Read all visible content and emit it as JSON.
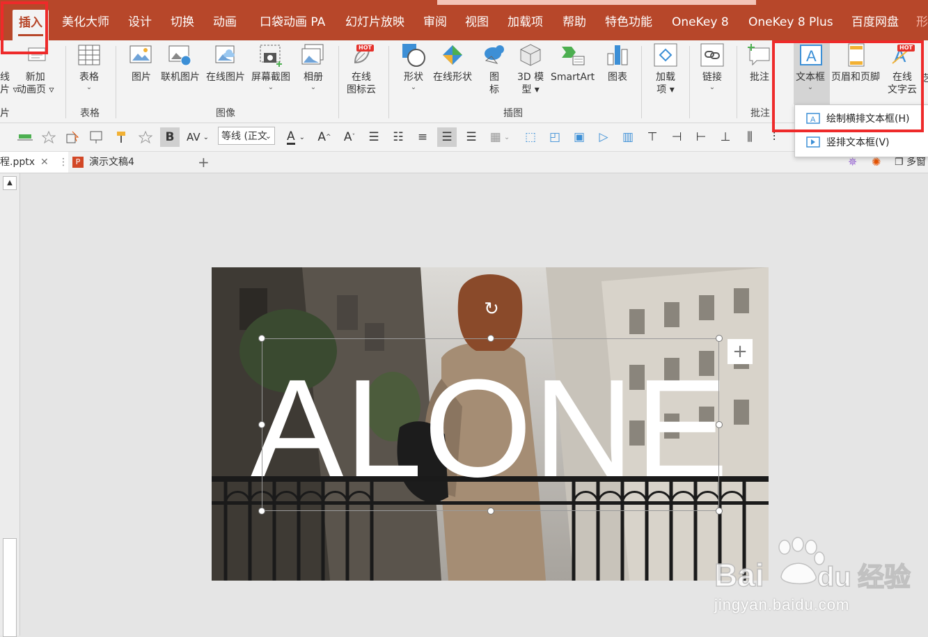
{
  "ribbon_tabs": [
    "插入",
    "美化大师",
    "设计",
    "切换",
    "动画",
    "口袋动画 PA",
    "幻灯片放映",
    "审阅",
    "视图",
    "加载项",
    "帮助",
    "特色功能",
    "OneKey 8",
    "OneKey 8 Plus",
    "百度网盘",
    "形"
  ],
  "active_tab": "插入",
  "ribbon": {
    "partial_left_labels": [
      "线",
      "片 ▿",
      "片"
    ],
    "new_animation_page": "新加",
    "new_animation_page_2": "动画页 ▿",
    "table": "表格",
    "table_group": "表格",
    "picture": "图片",
    "online_picture_1": "联机图片",
    "online_picture_2": "在线图片",
    "screenshot": "屏幕截图",
    "album": "相册",
    "image_group": "图像",
    "online_icon_cloud_1": "在线",
    "online_icon_cloud_2": "图标云",
    "hot_badge": "HOT",
    "shapes": "形状",
    "online_shapes": "在线形状",
    "icons_1": "图",
    "icons_2": "标",
    "model3d_1": "3D 模",
    "model3d_2": "型 ▾",
    "smartart": "SmartArt",
    "chart": "图表",
    "illustration_group": "插图",
    "addins_1": "加载",
    "addins_2": "项 ▾",
    "link": "链接",
    "comment": "批注",
    "comment_group": "批注",
    "textbox": "文本框",
    "header_footer": "页眉和页脚",
    "online_text_cloud_1": "在线",
    "online_text_cloud_2": "文字云",
    "cut_off": "艺"
  },
  "format_toolbar": {
    "bold": "B",
    "char_spacing": "AV",
    "font_name": "等线 (正文",
    "font_color": "A",
    "grow": "A",
    "shrink": "A"
  },
  "document_tabs": [
    {
      "name": "程.pptx"
    },
    {
      "name": "演示文稿4"
    }
  ],
  "multiwindow": "多窗",
  "slide": {
    "text": "ALONE"
  },
  "dropdown": {
    "item1": "绘制横排文本框(H)",
    "item2": "竖排文本框(V)"
  },
  "watermark": {
    "brand": "Bai du 经验",
    "url": "jingyan.baidu.com"
  },
  "colors": {
    "accent": "#b7472a",
    "highlight": "#ee2a2a",
    "ribbon_bg": "#f3f3f3"
  }
}
